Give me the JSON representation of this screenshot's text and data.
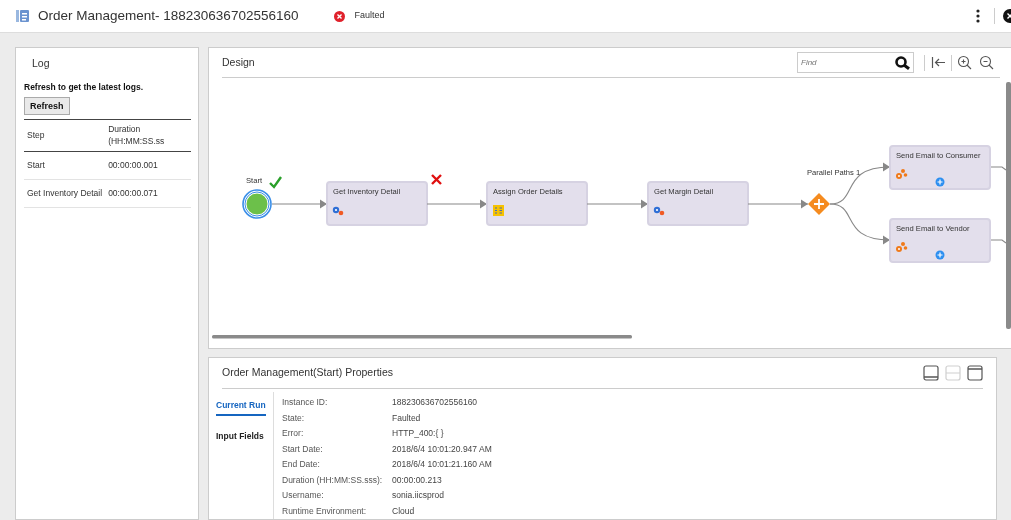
{
  "header": {
    "title": "Order Management- 188230636702556160",
    "status": "Faulted"
  },
  "log": {
    "title": "Log",
    "hint": "Refresh to get the latest logs.",
    "refresh_button": "Refresh",
    "columns": [
      "Step",
      "Duration (HH:MM:SS.ss"
    ],
    "rows": [
      {
        "step": "Start",
        "duration": "00:00:00.001"
      },
      {
        "step": "Get Inventory Detail",
        "duration": "00:00:00.071"
      }
    ]
  },
  "design": {
    "title": "Design",
    "search": {
      "placeholder": "Find"
    },
    "nodes": [
      {
        "kind": "start",
        "label": "Start",
        "succeeded": true,
        "failed": false
      },
      {
        "kind": "service",
        "label": "Get Inventory Detail",
        "succeeded": false,
        "failed": true
      },
      {
        "kind": "assignment",
        "label": "Assign Order Details",
        "succeeded": false,
        "failed": false
      },
      {
        "kind": "service",
        "label": "Get Margin Detail",
        "succeeded": false,
        "failed": false
      },
      {
        "kind": "parallel",
        "label": "Parallel Paths 1",
        "succeeded": false,
        "failed": false,
        "children": [
          {
            "kind": "notification",
            "label": "Send Email to Consumer",
            "succeeded": false,
            "failed": false
          },
          {
            "kind": "notification",
            "label": "Send Email to Vendor",
            "succeeded": false,
            "failed": false
          }
        ]
      }
    ]
  },
  "properties": {
    "title": "Order Management(Start) Properties",
    "layout_buttons": [
      {
        "disabled": false
      },
      {
        "disabled": true
      },
      {
        "disabled": false
      }
    ],
    "tabs": [
      {
        "label": "Current Run",
        "selected": true
      },
      {
        "label": "Input Fields",
        "selected": false
      }
    ],
    "fields": [
      {
        "label": "Instance ID:",
        "value": "188230636702556160"
      },
      {
        "label": "State:",
        "value": "Faulted"
      },
      {
        "label": "Error:",
        "value": "HTTP_400:{ }"
      },
      {
        "label": "Start Date:",
        "value": "2018/6/4 10:01:20.947 AM"
      },
      {
        "label": "End Date:",
        "value": "2018/6/4 10:01:21.160 AM"
      },
      {
        "label": "Duration (HH:MM:SS.sss):",
        "value": "00:00:00.213"
      },
      {
        "label": "Username:",
        "value": "sonia.iicsprod"
      },
      {
        "label": "Runtime Environment:",
        "value": "Cloud"
      }
    ]
  }
}
